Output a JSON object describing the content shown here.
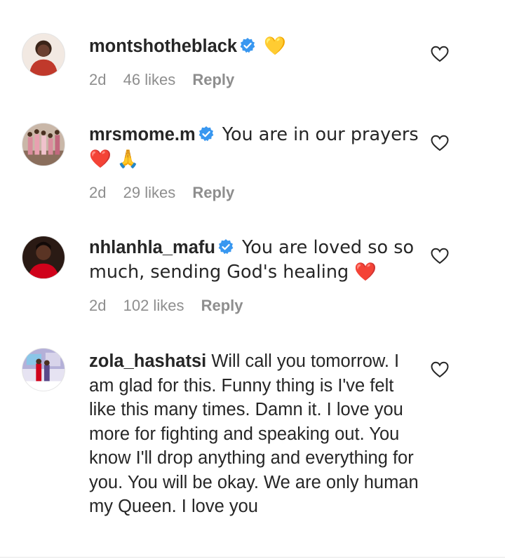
{
  "comments": [
    {
      "username": "montshotheblack",
      "verified": true,
      "text": "💛",
      "time": "2d",
      "likes": "46 likes",
      "reply": "Reply",
      "avatar_color": "#c0392b"
    },
    {
      "username": "mrsmome.m",
      "verified": true,
      "text": "You are in our prayers ❤️ 🙏",
      "time": "2d",
      "likes": "29 likes",
      "reply": "Reply",
      "avatar_color": "#d98c9c"
    },
    {
      "username": "nhlanhla_mafu",
      "verified": true,
      "text": "You are loved so so much, sending God's healing ❤️",
      "time": "2d",
      "likes": "102 likes",
      "reply": "Reply",
      "avatar_color": "#d0021b"
    },
    {
      "username": "zola_hashatsi",
      "verified": false,
      "text": "Will call you tomorrow. I am glad for this. Funny thing is I've felt like this many times. Damn it. I love you more for fighting and speaking out. You know I'll drop anything and everything for you. You will be okay. We are only human my Queen. I love you",
      "time": "",
      "likes": "",
      "reply": "",
      "avatar_color": "#b4b0d8"
    }
  ],
  "colors": {
    "verified_badge": "#3897f0",
    "meta_text": "#8e8e8e",
    "primary_text": "#262626"
  }
}
